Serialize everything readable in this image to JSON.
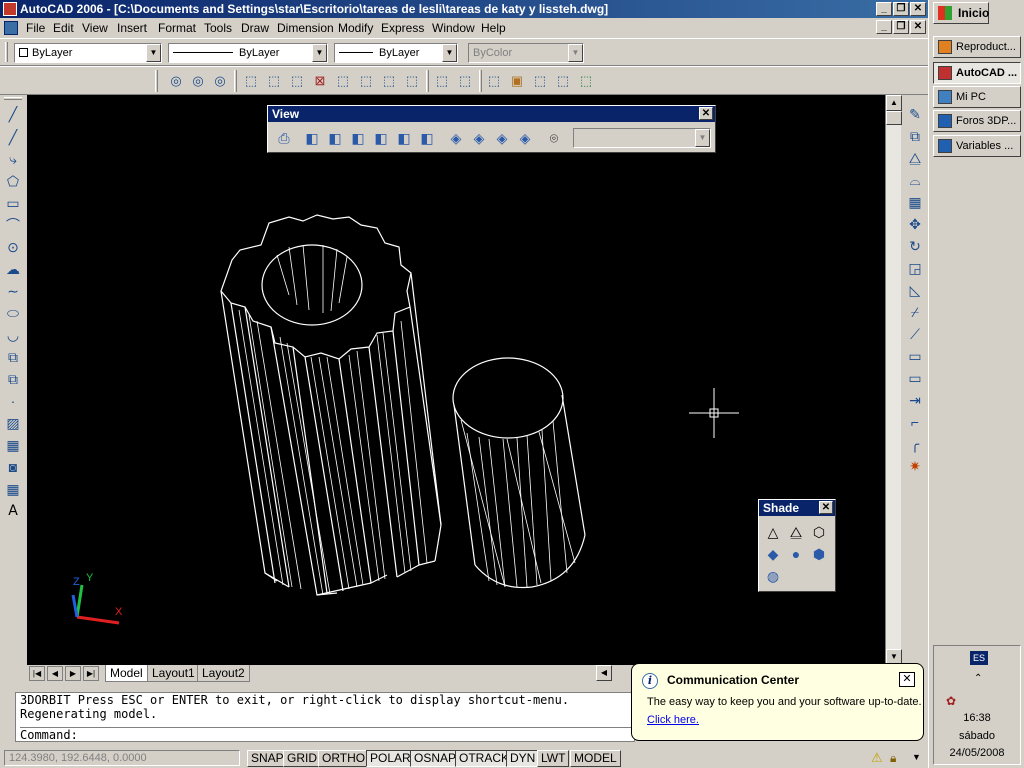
{
  "window": {
    "title": "AutoCAD 2006 - [C:\\Documents and Settings\\star\\Escritorio\\tareas de lesli\\tareas de katy y lissteh.dwg]"
  },
  "menu": {
    "items": [
      "File",
      "Edit",
      "View",
      "Insert",
      "Format",
      "Tools",
      "Draw",
      "Dimension",
      "Modify",
      "Express",
      "Window",
      "Help"
    ]
  },
  "properties": {
    "layer": "ByLayer",
    "linetype": "ByLayer",
    "lineweight": "ByLayer",
    "color": "ByColor"
  },
  "view_toolbar": {
    "title": "View",
    "combo_value": ""
  },
  "shade_toolbar": {
    "title": "Shade"
  },
  "tabs": {
    "model": "Model",
    "layout1": "Layout1",
    "layout2": "Layout2"
  },
  "command": {
    "line1": "3DORBIT Press ESC or ENTER to exit, or right-click to display shortcut-menu.",
    "line2": "Regenerating model.",
    "prompt": "Command:"
  },
  "status": {
    "coords": "124.3980, 192.6448, 0.0000",
    "buttons": [
      "SNAP",
      "GRID",
      "ORTHO",
      "POLAR",
      "OSNAP",
      "OTRACK",
      "DYN",
      "LWT",
      "MODEL"
    ]
  },
  "balloon": {
    "title": "Communication Center",
    "body": "The easy way to keep you and your software up-to-date.",
    "link": "Click here."
  },
  "ucs": {
    "x": "X",
    "y": "Y",
    "z": "Z"
  },
  "taskbar": {
    "start": "Inicio",
    "tasks": [
      "Reproduct...",
      "AutoCAD ...",
      "Mi PC",
      "Foros 3DP...",
      "Variables ..."
    ],
    "language": "ES",
    "time": "16:38",
    "day": "sábado",
    "date": "24/05/2008"
  },
  "colors": {
    "title_active": "#0a246a",
    "canvas": "#000000",
    "balloon_bg": "#ffffe1"
  }
}
